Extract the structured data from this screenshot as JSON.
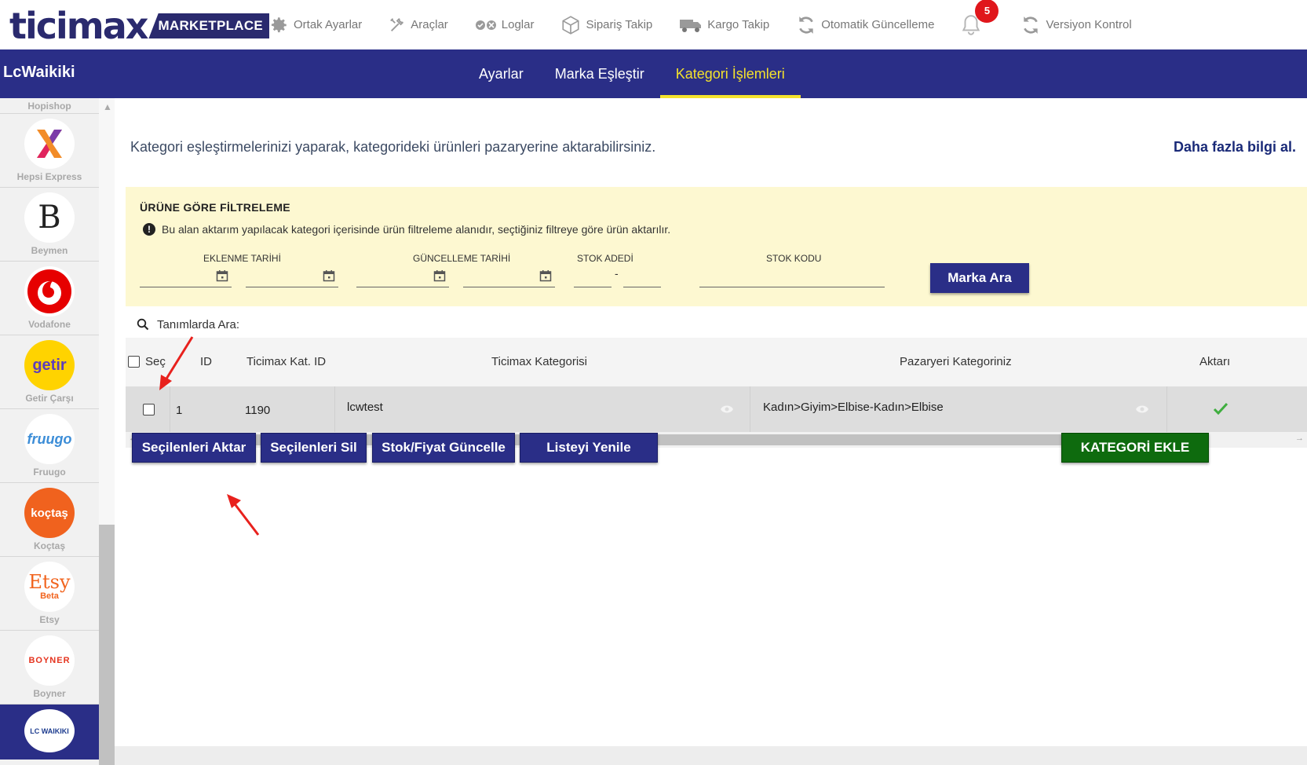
{
  "brand": {
    "logo_text": "ticimax",
    "logo_badge": "MARKETPLACE"
  },
  "topnav": {
    "items": [
      {
        "label": "Ortak Ayarlar",
        "icon": "gear-icon"
      },
      {
        "label": "Araçlar",
        "icon": "tools-icon"
      },
      {
        "label": "Loglar",
        "icon": "logs-icon"
      },
      {
        "label": "Sipariş Takip",
        "icon": "box-icon"
      },
      {
        "label": "Kargo Takip",
        "icon": "truck-icon"
      },
      {
        "label": "Otomatik Güncelleme",
        "icon": "refresh-icon"
      },
      {
        "label": "Versiyon Kontrol",
        "icon": "refresh-icon"
      }
    ],
    "notification_count": "5"
  },
  "header": {
    "store_name": "LcWaikiki",
    "tabs": [
      {
        "label": "Ayarlar"
      },
      {
        "label": "Marka Eşleştir"
      },
      {
        "label": "Kategori İşlemleri"
      }
    ],
    "active_tab": "Kategori İşlemleri"
  },
  "sidebar": {
    "items": [
      {
        "label": "Hopishop"
      },
      {
        "label": "Hepsi Express"
      },
      {
        "label": "Beymen"
      },
      {
        "label": "Vodafone"
      },
      {
        "label": "Getir Çarşı"
      },
      {
        "label": "Fruugo"
      },
      {
        "label": "Koçtaş"
      },
      {
        "label": "Etsy"
      },
      {
        "label": "Boyner"
      },
      {
        "label": "LC WAIKIKI"
      }
    ],
    "logos": {
      "beymen": "B",
      "getir": "getir",
      "fruugo": "fruugo",
      "koctas": "koçtaş",
      "etsy": "Etsy",
      "etsy_beta": "Beta",
      "boyner": "BOYNER",
      "lcw": "LC WAIKIKI"
    }
  },
  "main": {
    "intro": "Kategori eşleştirmelerinizi yaparak, kategorideki ürünleri pazaryerine aktarabilirsiniz.",
    "more_info": "Daha fazla bilgi al.",
    "filter": {
      "title": "ÜRÜNE GÖRE FİLTRELEME",
      "note": "Bu alan aktarım yapılacak kategori içerisinde ürün filtreleme alanıdır, seçtiğiniz filtreye göre ürün aktarılır.",
      "labels": {
        "added_date": "EKLENME TARİHİ",
        "updated_date": "GÜNCELLEME TARİHİ",
        "stock_count": "STOK ADEDİ",
        "stock_code": "STOK KODU"
      },
      "range_separator": "-",
      "search_button": "Marka Ara"
    },
    "search": {
      "label": "Tanımlarda Ara:"
    },
    "table": {
      "columns": [
        "Seç",
        "ID",
        "Ticimax Kat. ID",
        "Ticimax Kategorisi",
        "Pazaryeri Kategoriniz",
        "Aktarı"
      ],
      "rows": [
        {
          "id": "1",
          "ticimax_cat_id": "1190",
          "ticimax_category": "lcwtest",
          "marketplace_category": "Kadın>Giyim>Elbise-Kadın>Elbise",
          "transferred": true
        }
      ]
    },
    "actions": {
      "transfer_selected": "Seçilenleri Aktar",
      "delete_selected": "Seçilenleri Sil",
      "update_stock_price": "Stok/Fiyat Güncelle",
      "refresh_list": "Listeyi Yenile",
      "add_category": "KATEGORİ EKLE"
    }
  },
  "colors": {
    "brand_navy": "#2a2e87",
    "active_tab": "#f4e22c",
    "filter_bg": "#fdf8d1",
    "add_button": "#0e6b0e",
    "badge_red": "#e0161b",
    "annotation_arrow": "#e8211d"
  }
}
